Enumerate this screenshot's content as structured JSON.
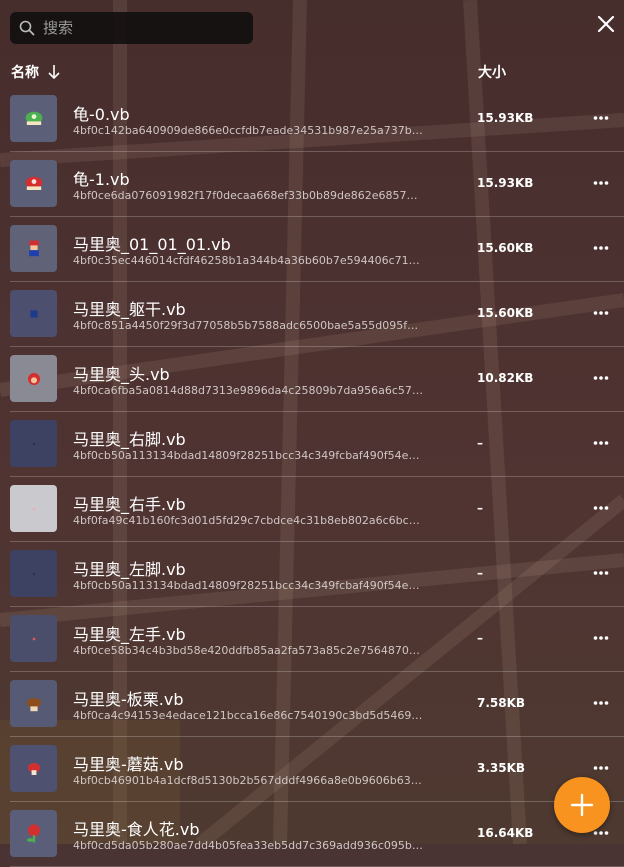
{
  "search": {
    "placeholder": "搜索"
  },
  "header": {
    "name_label": "名称",
    "size_label": "大小"
  },
  "files": [
    {
      "name": "龟-0.vb",
      "hash": "4bf0c142ba640909de866e0ccfdb7eade34531b987e25a737bf9...",
      "size": "15.93KB",
      "thumb": "green-shell",
      "thumb_bg": "#5b5f78"
    },
    {
      "name": "龟-1.vb",
      "hash": "4bf0ce6da076091982f17f0decaa668ef33b0b89de862e6857890...",
      "size": "15.93KB",
      "thumb": "red-shell",
      "thumb_bg": "#5b5f78"
    },
    {
      "name": "马里奥_01_01_01.vb",
      "hash": "4bf0c35ec446014cfdf46258b1a344b4a36b60b7e594406c71d3...",
      "size": "15.60KB",
      "thumb": "mario",
      "thumb_bg": "#606378"
    },
    {
      "name": "马里奥_躯干.vb",
      "hash": "4bf0c851a4450f29f3d77058b5b7588adc6500bae5a55d095fc50...",
      "size": "15.60KB",
      "thumb": "torso",
      "thumb_bg": "#4c4f6d"
    },
    {
      "name": "马里奥_头.vb",
      "hash": "4bf0ca6fba5a0814d88d7313e9896da4c25809b7da956a6c57cc...",
      "size": "10.82KB",
      "thumb": "head",
      "thumb_bg": "#8a8a94"
    },
    {
      "name": "马里奥_右脚.vb",
      "hash": "4bf0cb50a113134bdad14809f28251bcc34c349fcbaf490f54e600...",
      "size": "–",
      "thumb": "dot",
      "thumb_bg": "#3e4262"
    },
    {
      "name": "马里奥_右手.vb",
      "hash": "4bf0fa49c41b160fc3d01d5fd29c7cbdce4c31b8eb802a6c6bcd3f...",
      "size": "–",
      "thumb": "dot-light",
      "thumb_bg": "#c9c9ce"
    },
    {
      "name": "马里奥_左脚.vb",
      "hash": "4bf0cb50a113134bdad14809f28251bcc34c349fcbaf490f54e600...",
      "size": "–",
      "thumb": "dot",
      "thumb_bg": "#3e4262"
    },
    {
      "name": "马里奥_左手.vb",
      "hash": "4bf0ce58b34c4b3bd58e420ddfb85aa2fa573a85c2e7564870cf4...",
      "size": "–",
      "thumb": "dot-red",
      "thumb_bg": "#4a4e6a"
    },
    {
      "name": "马里奥-板栗.vb",
      "hash": "4bf0ca4c94153e4edace121bcca16e86c7540190c3bd5d5469d7...",
      "size": "7.58KB",
      "thumb": "goomba",
      "thumb_bg": "#565a74"
    },
    {
      "name": "马里奥-蘑菇.vb",
      "hash": "4bf0cb46901b4a1dcf8d5130b2b567dddf4966a8e0b9606b63ce...",
      "size": "3.35KB",
      "thumb": "mushroom",
      "thumb_bg": "#4e5270"
    },
    {
      "name": "马里奥-食人花.vb",
      "hash": "4bf0cd5da05b280ae7dd4b05fea33eb5dd7c369add936c095bf9...",
      "size": "16.64KB",
      "thumb": "piranha",
      "thumb_bg": "#5a5e78"
    }
  ],
  "colors": {
    "accent": "#f7931e",
    "background": "#4a3433"
  }
}
